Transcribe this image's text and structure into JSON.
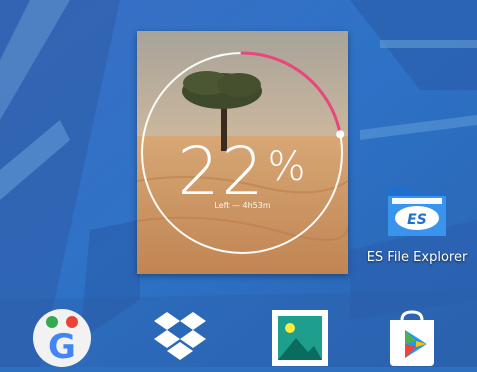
{
  "widget": {
    "percent_value": "22",
    "percent_unit": "%",
    "battery_level": 0.22,
    "time_left": "Left — 4h53m",
    "ring_color": "#e8467c"
  },
  "apps": {
    "es_file_explorer": {
      "label": "ES File Explorer",
      "icon": "es-file-explorer-icon"
    },
    "google": {
      "icon": "google-folder-icon"
    },
    "dropbox": {
      "icon": "dropbox-icon"
    },
    "gallery": {
      "icon": "gallery-icon"
    },
    "play_store": {
      "icon": "play-store-icon"
    }
  }
}
